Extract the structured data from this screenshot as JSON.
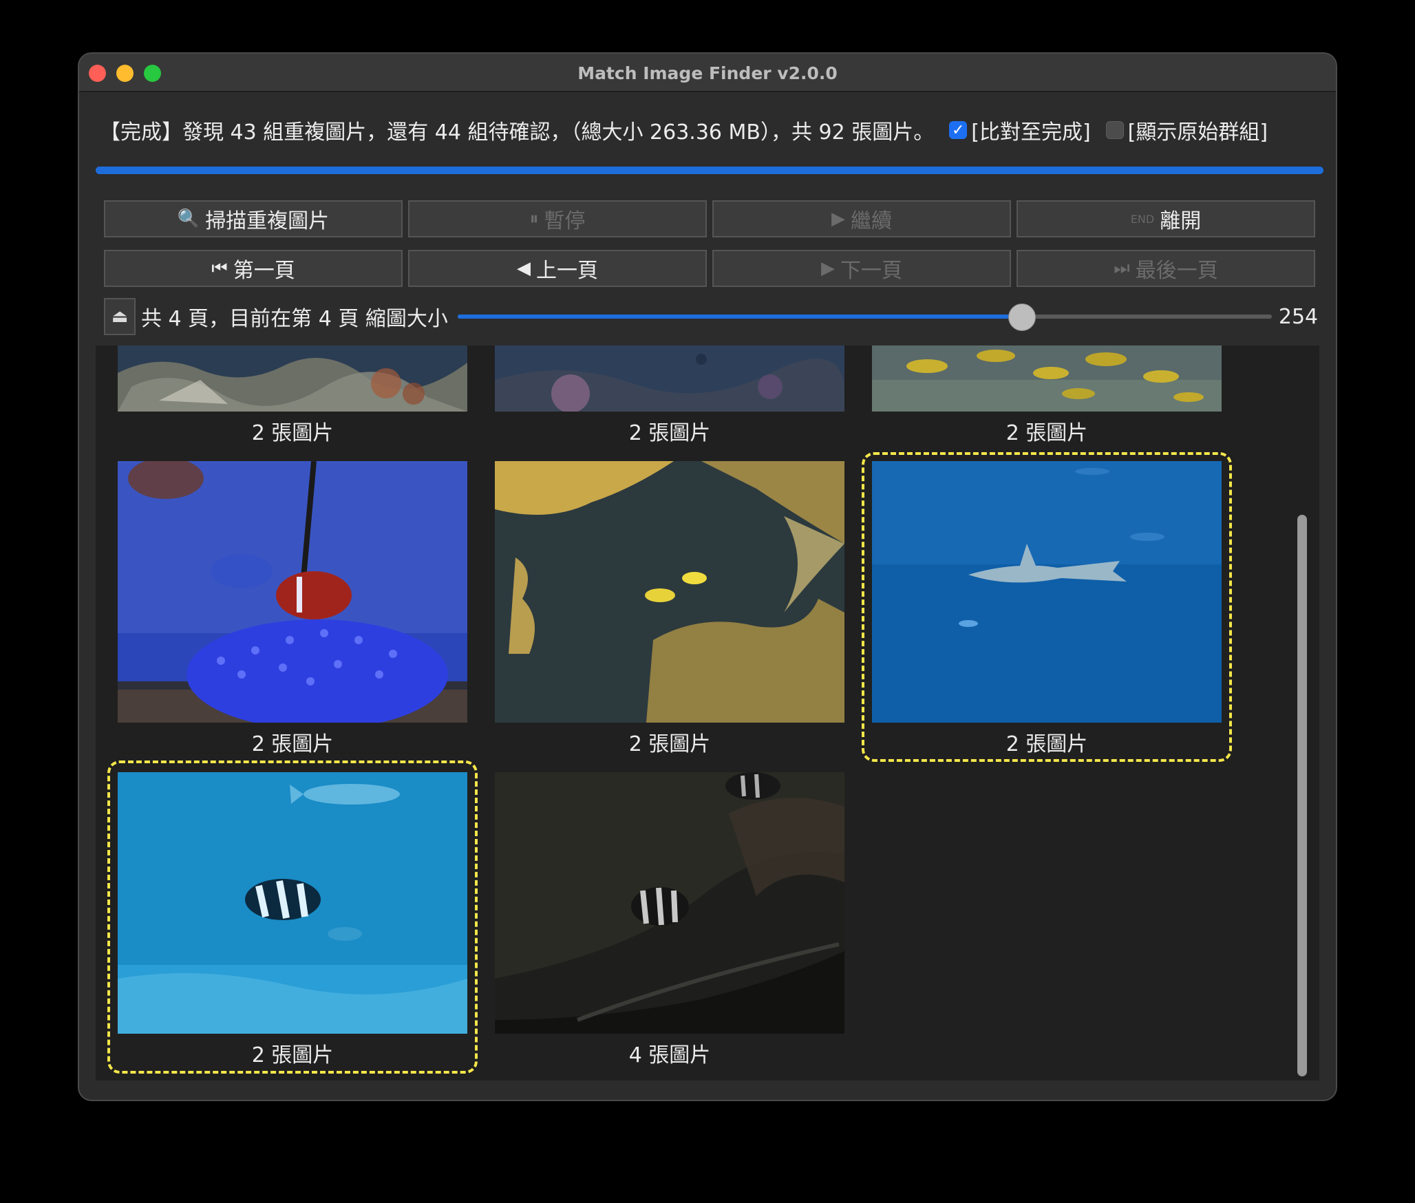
{
  "window": {
    "title": "Match Image Finder v2.0.0"
  },
  "status": {
    "text": "【完成】發現 43 組重複圖片，還有 44 組待確認，（總大小 263.36 MB），共 92 張圖片。",
    "check_complete_label": "[比對至完成]",
    "check_complete_checked": true,
    "check_original_label": "[顯示原始群組]",
    "check_original_checked": false
  },
  "progress": {
    "value": 1.0
  },
  "toolbar": {
    "scan_label": "掃描重複圖片",
    "pause_label": "暫停",
    "resume_label": "繼續",
    "exit_label": "離開",
    "first_label": "第一頁",
    "prev_label": "上一頁",
    "next_label": "下一頁",
    "last_label": "最後一頁"
  },
  "pager": {
    "info": "共 4 頁，目前在第 4 頁 縮圖大小",
    "thumb_size_value": "254",
    "slider_fraction": 0.7
  },
  "gallery": {
    "items": [
      {
        "caption": "2 張圖片",
        "scene": "coral reef"
      },
      {
        "caption": "2 張圖片",
        "scene": "dark reef"
      },
      {
        "caption": "2 張圖片",
        "scene": "yellow fish school"
      },
      {
        "caption": "2 張圖片",
        "scene": "clownfish over anemone"
      },
      {
        "caption": "2 張圖片",
        "scene": "yellow fish in reef"
      },
      {
        "caption": "2 張圖片",
        "scene": "shark in blue water",
        "selected": true
      },
      {
        "caption": "2 張圖片",
        "scene": "striped fish in blue water",
        "selected": true
      },
      {
        "caption": "4 張圖片",
        "scene": "striped fish in dark tank"
      }
    ]
  }
}
